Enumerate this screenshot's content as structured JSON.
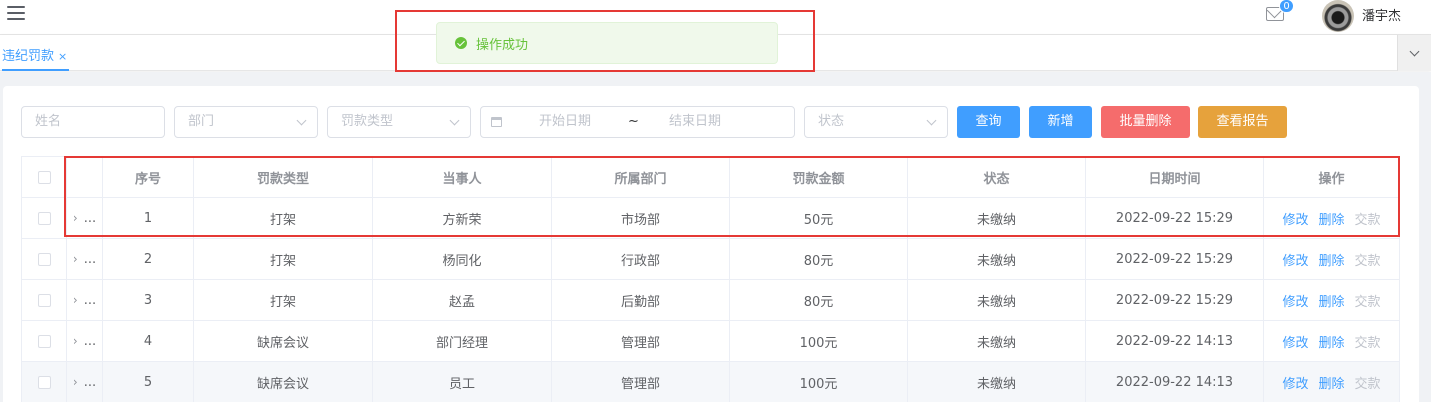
{
  "header": {
    "user_name": "潘宇杰",
    "message_count": "0"
  },
  "tags": [
    {
      "label": "违纪罚款",
      "close": "×"
    }
  ],
  "toast": {
    "message": "操作成功"
  },
  "filters": {
    "name_placeholder": "姓名",
    "dept_placeholder": "部门",
    "type_placeholder": "罚款类型",
    "start_placeholder": "开始日期",
    "range_separator": "~",
    "end_placeholder": "结束日期",
    "status_placeholder": "状态"
  },
  "buttons": {
    "query": "查询",
    "add": "新增",
    "batch_delete": "批量删除",
    "view_report": "查看报告"
  },
  "colors": {
    "primary": "#409eff",
    "danger": "#f56c6c",
    "warning": "#e6a23c",
    "success": "#67c23a",
    "highlight": "#e53935"
  },
  "table": {
    "columns": [
      "序号",
      "罚款类型",
      "当事人",
      "所属部门",
      "罚款金额",
      "状态",
      "日期时间",
      "操作"
    ],
    "expand_text": "...",
    "rows": [
      {
        "index": "1",
        "type": "打架",
        "person": "方新荣",
        "dept": "市场部",
        "amount": "50元",
        "status": "未缴纳",
        "datetime": "2022-09-22 15:29"
      },
      {
        "index": "2",
        "type": "打架",
        "person": "杨同化",
        "dept": "行政部",
        "amount": "80元",
        "status": "未缴纳",
        "datetime": "2022-09-22 15:29"
      },
      {
        "index": "3",
        "type": "打架",
        "person": "赵孟",
        "dept": "后勤部",
        "amount": "80元",
        "status": "未缴纳",
        "datetime": "2022-09-22 15:29"
      },
      {
        "index": "4",
        "type": "缺席会议",
        "person": "部门经理",
        "dept": "管理部",
        "amount": "100元",
        "status": "未缴纳",
        "datetime": "2022-09-22 14:13"
      },
      {
        "index": "5",
        "type": "缺席会议",
        "person": "员工",
        "dept": "管理部",
        "amount": "100元",
        "status": "未缴纳",
        "datetime": "2022-09-22 14:13"
      }
    ],
    "actions": {
      "edit": "修改",
      "delete": "删除",
      "pay": "交款"
    }
  }
}
